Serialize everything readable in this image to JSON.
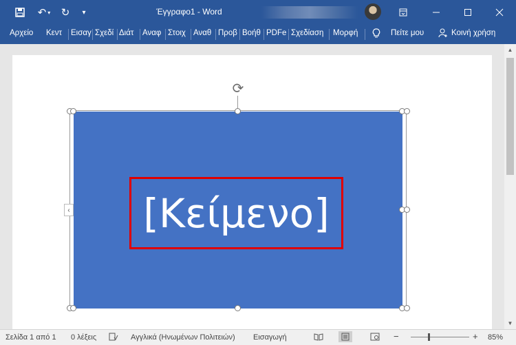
{
  "window": {
    "doc_title": "Έγγραφο1",
    "separator": "-",
    "app_name": "Word",
    "save_icon": "save-icon",
    "undo_icon": "undo-icon",
    "redo_icon": "redo-icon"
  },
  "ribbon": {
    "tabs": [
      "Αρχείο",
      "Κεντ",
      "Εισαγ",
      "Σχεδί",
      "Διάτ",
      "Αναφ",
      "Στοιχ",
      "Αναθ",
      "Προβ",
      "Βοήθ",
      "PDFe",
      "Σχεδίαση",
      "Μορφή"
    ],
    "tell_me": "Πείτε μου",
    "share": "Κοινή χρήση"
  },
  "shape": {
    "text": "[Κείμενο]",
    "fill_color": "#4472c4",
    "highlight_color": "#e00000"
  },
  "status": {
    "page": "Σελίδα 1 από 1",
    "words": "0 λέξεις",
    "language": "Αγγλικά (Ηνωμένων Πολιτειών)",
    "mode": "Εισαγωγή",
    "zoom_minus": "−",
    "zoom_plus": "+",
    "zoom": "85%"
  }
}
